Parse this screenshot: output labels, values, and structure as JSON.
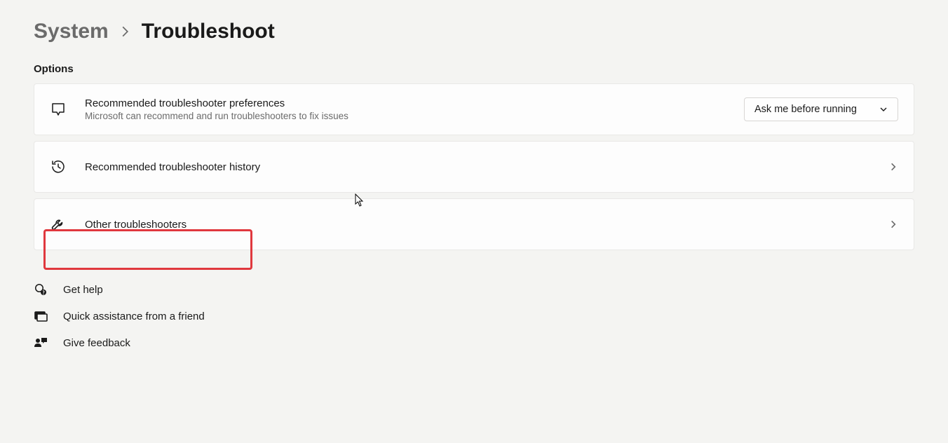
{
  "breadcrumb": {
    "parent": "System",
    "current": "Troubleshoot"
  },
  "section": {
    "header": "Options"
  },
  "cards": {
    "preferences": {
      "title": "Recommended troubleshooter preferences",
      "desc": "Microsoft can recommend and run troubleshooters to fix issues",
      "dropdown_value": "Ask me before running"
    },
    "history": {
      "title": "Recommended troubleshooter history"
    },
    "other": {
      "title": "Other troubleshooters"
    }
  },
  "help": {
    "get_help": "Get help",
    "quick_assist": "Quick assistance from a friend",
    "feedback": "Give feedback"
  }
}
